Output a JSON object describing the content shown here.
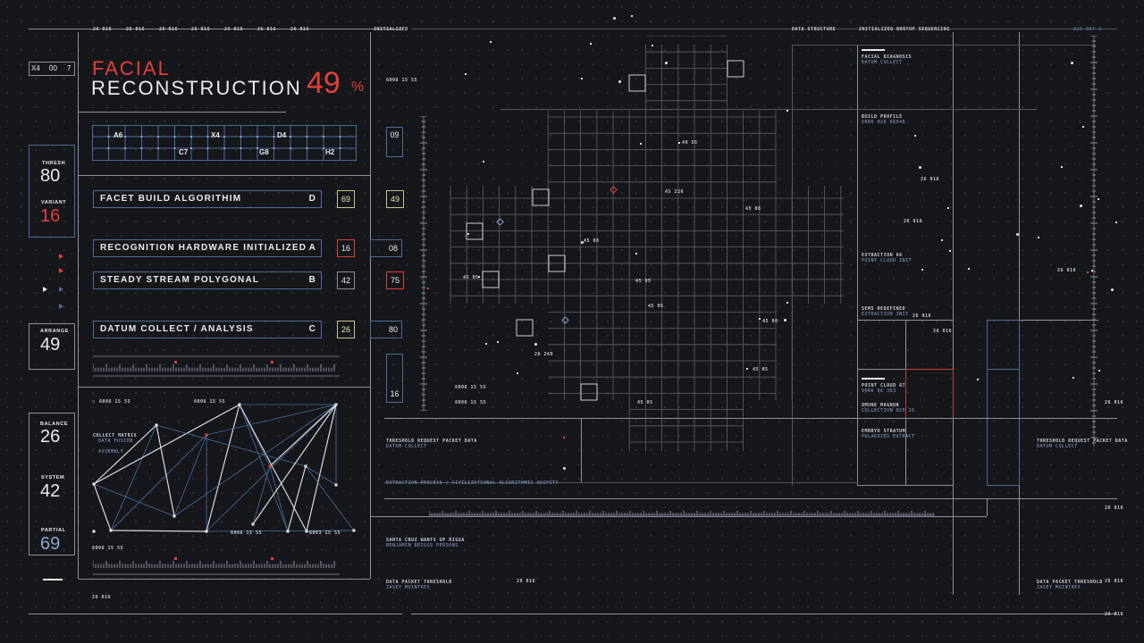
{
  "header": {
    "top_codes": [
      "26 016",
      "26 016",
      "26 016",
      "26 016",
      "26 016",
      "26 016",
      "26 016"
    ],
    "initialized": "INITIALIZED",
    "data_structure": "DATA STRUCTURE",
    "initialized_bootup": "INITIALIZED BOOTUP SEQUENCING",
    "code_right": "026 007 3"
  },
  "index_box": {
    "a": "X4",
    "b": "00",
    "c": "7"
  },
  "title": {
    "line1": "FACIAL",
    "line2": "RECONSTRUCTION",
    "percent_value": "49",
    "percent_sign": "%"
  },
  "grid_labels": {
    "a6": "A6",
    "x4": "X4",
    "d4": "D4",
    "c7": "C7",
    "g8": "G8",
    "h2": "H2"
  },
  "stats": [
    {
      "label": "THRESH",
      "value": "80"
    },
    {
      "label": "VARIANT",
      "value": "16"
    },
    {
      "label": "ARRANGE",
      "value": "49"
    },
    {
      "label": "BALANCE",
      "value": "26"
    },
    {
      "label": "SYSTEM",
      "value": "42"
    },
    {
      "label": "PARTIAL",
      "value": "69"
    }
  ],
  "processes": [
    {
      "label": "FACET BUILD ALGORITHIM",
      "code": "D",
      "value": "69",
      "right": "49"
    },
    {
      "label": "RECOGNITION HARDWARE INITIALIZED",
      "code": "A",
      "value": "16",
      "right": "08"
    },
    {
      "label": "STEADY STREAM POLYGONAL",
      "code": "B",
      "value": "42",
      "right": "75"
    },
    {
      "label": "DATUM COLLECT / ANALYSIS",
      "code": "C",
      "value": "26",
      "right": "80"
    }
  ],
  "side_boxes": {
    "top": "09",
    "bottom": "16"
  },
  "network": {
    "code_a": "6006 15 55",
    "code_b": "6006 15 55",
    "code_c": "6006 15 55",
    "code_d": "6006 15 55",
    "code_e": "6006 15 55",
    "collect_matrix": "COLLECT MATRIX",
    "data_fusion": "DATA FUSION",
    "assembly": "ASSEMBLY",
    "node_code_1": "6006 15 55",
    "node_code_2": "6003 15 55",
    "node_code_3": "6006 15 55"
  },
  "small_code": "26 016",
  "grid_map": {
    "labels": [
      "49 55",
      "45 226",
      "45 08",
      "45 08",
      "45 05",
      "45 05",
      "26 269",
      "45 08",
      "45 05",
      "45 05",
      "45 05"
    ]
  },
  "right_panel": {
    "facial_diagnosis": "FACIAL DIAGNOSIS",
    "datum_collect": "DATUM COLLECT",
    "build_profile": "BUILD PROFILE",
    "build_profile_sub": "V6R6 026 66046",
    "extraction": "EXTRACTION 66",
    "extraction_sub": "POINT CLOUD INIT",
    "sems_redefined": "SEMS REDEFINED",
    "sems_redefined_sub": "EXTRACTION INIT",
    "point_cloud": "POINT CLOUD 6T",
    "point_cloud_sub": "V6R6 06 363",
    "omune": "OMUNE MAGNUR",
    "omune_sub": "COLLECTION 655 26",
    "embryo": "EMBRYO STRATUM",
    "embryo_sub": "POLARIZED EXTRACT",
    "codes": [
      "26 016",
      "26 016",
      "26 016",
      "26 016",
      "26 016",
      "26 016"
    ]
  },
  "bottom": {
    "threshold": "THRESHOLD REQUEST PACKET DATA",
    "threshold_sub": "DATUM COLLECT",
    "extraction_process": "EXTRACTION PROCESS / CIVILIZATIONAL ALGORITHMIC ODIPITY",
    "santa": "SANTA CRUZ WANTS UP RIGGA",
    "santa_sub": "BENJAMIN BRIGGS PERSONS",
    "packet": "DATA PACKET THRESHOLD",
    "packet_sub": "ZASEY MOINTRES",
    "threshold_right": "THRESHOLD REQUEST PACKET DATA",
    "threshold_right_sub": "DATUM COLLECT",
    "packet_right": "DATA PACKET THRESHOLD",
    "packet_right_sub": "ZASEY MOINTRES",
    "codes": [
      "26 016",
      "26 016",
      "26 016",
      "26 016",
      "26 016"
    ]
  },
  "colors": {
    "accent_red": "#e0403a",
    "line_gray": "#8b919c",
    "line_blue": "#4d6b96",
    "background": "#16171b"
  }
}
